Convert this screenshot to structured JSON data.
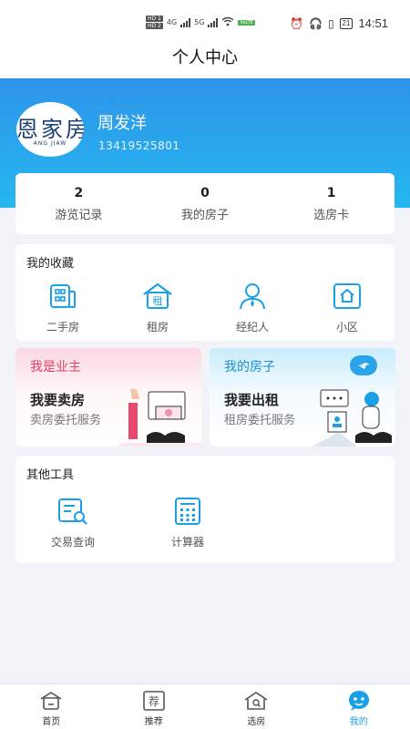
{
  "status": {
    "hd1": "HD 1",
    "hd2": "HD 2",
    "net": "4G",
    "net2": "5G",
    "volte": "VoLTE",
    "battery": "21",
    "time": "14:51"
  },
  "header": {
    "title": "个人中心"
  },
  "user": {
    "name": "周发洋",
    "phone": "13419525801",
    "avatar_brand": "恩家房",
    "avatar_brand_sub": "ANG JIAW"
  },
  "stats": [
    {
      "value": "2",
      "label": "游览记录"
    },
    {
      "value": "0",
      "label": "我的房子"
    },
    {
      "value": "1",
      "label": "选房卡"
    }
  ],
  "favorites": {
    "title": "我的收藏",
    "items": [
      {
        "label": "二手房",
        "icon": "building-icon"
      },
      {
        "label": "租房",
        "icon": "rent-house-icon"
      },
      {
        "label": "经纪人",
        "icon": "agent-icon"
      },
      {
        "label": "小区",
        "icon": "community-icon"
      }
    ]
  },
  "promos": {
    "owner": {
      "tag": "我是业主",
      "title": "我要卖房",
      "subtitle": "卖房委托服务"
    },
    "rent": {
      "tag": "我的房子",
      "title": "我要出租",
      "subtitle": "租房委托服务"
    }
  },
  "tools": {
    "title": "其他工具",
    "items": [
      {
        "label": "交易查询",
        "icon": "search-document-icon"
      },
      {
        "label": "计算器",
        "icon": "calculator-icon"
      }
    ]
  },
  "tabbar": {
    "active": "我的",
    "items": [
      {
        "label": "首页",
        "icon": "home-icon",
        "glyph": ""
      },
      {
        "label": "推荐",
        "icon": "recommend-icon",
        "glyph": "荐"
      },
      {
        "label": "选房",
        "icon": "house-search-icon",
        "glyph": ""
      },
      {
        "label": "我的",
        "icon": "profile-icon",
        "glyph": ""
      }
    ]
  },
  "colors": {
    "accent": "#1aa0e6",
    "header_gradient_top": "#2e94ea",
    "header_gradient_bottom": "#25b7ef",
    "owner_tag": "#e0415f",
    "rent_tag": "#1b8fd0"
  }
}
